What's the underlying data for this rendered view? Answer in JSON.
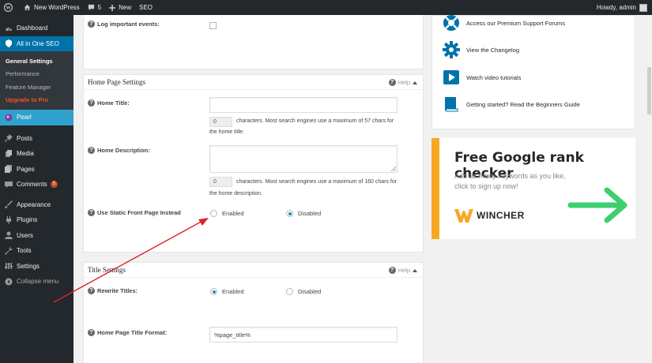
{
  "adminbar": {
    "site_name": "New WordPress",
    "comments_count": "5",
    "new_label": "New",
    "seo_label": "SEO",
    "greeting": "Howdy, admin"
  },
  "sidebar": {
    "items": [
      {
        "label": "Dashboard",
        "icon": "dashboard-icon"
      },
      {
        "label": "All in One SEO",
        "icon": "aioseo-icon"
      },
      {
        "label": "Pearl",
        "icon": "pearl-icon"
      },
      {
        "label": "Posts",
        "icon": "pin-icon"
      },
      {
        "label": "Media",
        "icon": "media-icon"
      },
      {
        "label": "Pages",
        "icon": "pages-icon"
      },
      {
        "label": "Comments",
        "icon": "comments-icon",
        "badge": "5"
      },
      {
        "label": "Appearance",
        "icon": "appearance-icon"
      },
      {
        "label": "Plugins",
        "icon": "plugins-icon"
      },
      {
        "label": "Users",
        "icon": "users-icon"
      },
      {
        "label": "Tools",
        "icon": "tools-icon"
      },
      {
        "label": "Settings",
        "icon": "settings-icon"
      },
      {
        "label": "Collapse menu",
        "icon": "collapse-icon"
      }
    ],
    "submenu": [
      "General Settings",
      "Performance",
      "Feature Manager",
      "Upgrade to Pro"
    ]
  },
  "top_panel": {
    "log_label": "Log important events:"
  },
  "home_page_settings": {
    "title": "Home Page Settings",
    "help": "Help",
    "home_title_label": "Home Title:",
    "home_title_value": "",
    "home_title_count": "0",
    "home_title_note_1": "characters. Most search engines use a maximum of 57 chars for",
    "home_title_note_2": "the home title.",
    "home_desc_label": "Home Description:",
    "home_desc_value": "",
    "home_desc_count": "0",
    "home_desc_note_1": "characters. Most search engines use a maximum of 160 chars for",
    "home_desc_note_2": "the home description.",
    "static_label": "Use Static Front Page Instead",
    "enabled": "Enabled",
    "disabled": "Disabled",
    "selected": "Disabled"
  },
  "title_settings": {
    "title": "Title Settings",
    "help": "Help",
    "rewrite_label": "Rewrite Titles:",
    "enabled": "Enabled",
    "disabled": "Disabled",
    "selected": "Enabled",
    "format_label": "Home Page Title Format:",
    "format_value": "%page_title%"
  },
  "support": {
    "items": [
      {
        "label": "Access our Premium Support Forums",
        "icon": "lifebuoy-icon"
      },
      {
        "label": "View the Changelog",
        "icon": "gear-icon"
      },
      {
        "label": "Watch video tutorials",
        "icon": "video-icon"
      },
      {
        "label": "Getting started? Read the Beginners Guide",
        "icon": "book-icon"
      }
    ]
  },
  "wincher": {
    "title": "Free Google rank checker",
    "sub_1": "Add as many keywords as you like,",
    "sub_2": "click to sign up now!",
    "brand": "WINCHER",
    "accent": "#f7a823",
    "arrow_color": "#3dcf6e"
  },
  "colors": {
    "adminbar": "#23282d",
    "sidebar": "#23282d",
    "active": "#0073aa",
    "annotation_arrow": "#d9262b"
  }
}
